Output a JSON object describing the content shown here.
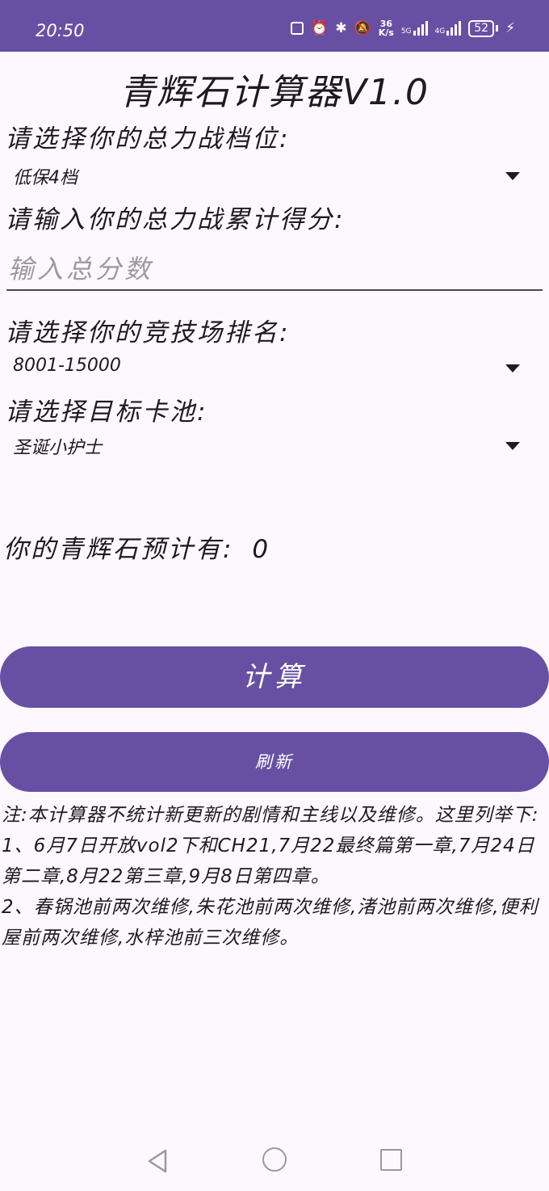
{
  "status_bar": {
    "time": "20:50",
    "net_speed_top": "36",
    "net_speed_bottom": "K/s",
    "sig1_label": "5G",
    "sig2_label": "4G",
    "battery": "52"
  },
  "app": {
    "title": "青辉石计算器V1.0"
  },
  "form": {
    "tier_label": "请选择你的总力战档位:",
    "tier_value": "低保4档",
    "score_label": "请输入你的总力战累计得分:",
    "score_placeholder": "输入总分数",
    "score_value": "",
    "arena_label": "请选择你的竞技场排名:",
    "arena_value": "8001-15000",
    "pool_label": "请选择目标卡池:",
    "pool_value": "圣诞小护士"
  },
  "result": {
    "label": "你的青辉石预计有:",
    "value": "0"
  },
  "buttons": {
    "calculate": "计算",
    "refresh": "刷新"
  },
  "notes": {
    "line1": "注:本计算器不统计新更新的剧情和主线以及维修。这里列举下:",
    "line2": "1、6月7日开放vol2下和CH21,7月22最终篇第一章,7月24日第二章,8月22第三章,9月8日第四章。",
    "line3": "2、春锅池前两次维修,朱花池前两次维修,渚池前两次维修,便利屋前两次维修,水梓池前三次维修。"
  },
  "colors": {
    "primary": "#6750a4",
    "background": "#fdf8fd",
    "text": "#1c1b1f"
  },
  "icons": [
    "nfc-icon",
    "alarm-icon",
    "bluetooth-icon",
    "mute-icon",
    "signal-icon",
    "battery-icon",
    "charging-icon",
    "back-icon",
    "home-icon",
    "recents-icon"
  ]
}
